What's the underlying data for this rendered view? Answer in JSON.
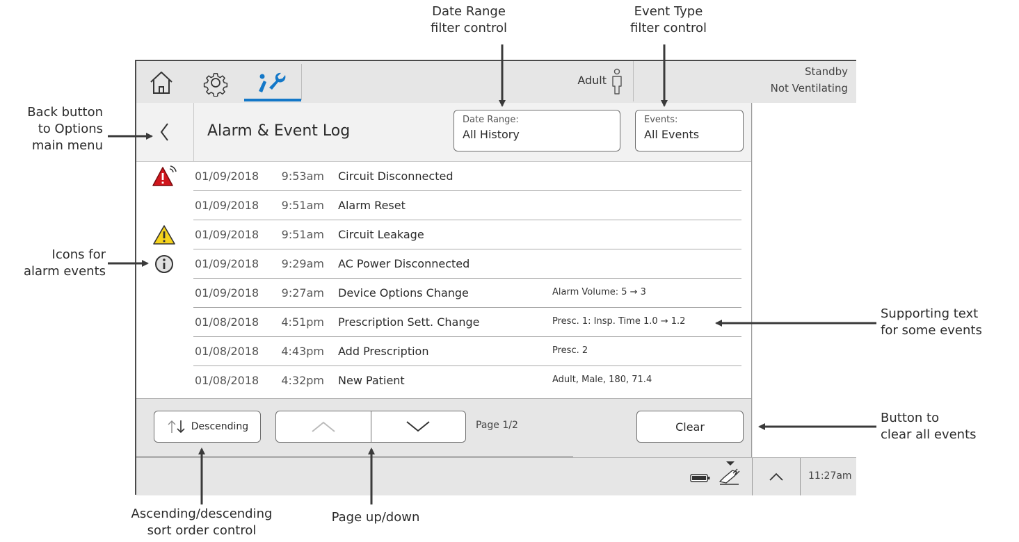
{
  "callouts": {
    "date_range": [
      "Date Range",
      "filter control"
    ],
    "event_type": [
      "Event Type",
      "filter control"
    ],
    "back_button": [
      "Back button",
      "to Options",
      "main menu"
    ],
    "alarm_icons": [
      "Icons for",
      "alarm events"
    ],
    "supporting_text": [
      "Supporting text",
      "for some events"
    ],
    "clear_button": [
      "Button to",
      "clear all events"
    ],
    "sort_order": [
      "Ascending/descending",
      "sort order control"
    ],
    "page_nav": [
      "Page up/down"
    ]
  },
  "topbar": {
    "tabs": [
      {
        "icon": "home-icon"
      },
      {
        "icon": "gear-icon"
      },
      {
        "icon": "tools-icon",
        "active": true
      }
    ],
    "patient_mode": "Adult",
    "patient_icon": "adult-patient-icon",
    "status_line1": "Standby",
    "status_line2": "Not Ventilating",
    "active_tab_color": "#1478c8"
  },
  "panel": {
    "title": "Alarm & Event Log",
    "back_icon": "chevron-left-icon",
    "date_filter": {
      "label": "Date Range:",
      "value": "All History"
    },
    "event_filter": {
      "label": "Events:",
      "value": "All Events"
    }
  },
  "log": [
    {
      "icon": "high-priority-alarm-icon",
      "date": "01/09/2018",
      "time": "9:53am",
      "event": "Circuit Disconnected",
      "note": ""
    },
    {
      "icon": "",
      "date": "01/09/2018",
      "time": "9:51am",
      "event": "Alarm Reset",
      "note": ""
    },
    {
      "icon": "medium-priority-alarm-icon",
      "date": "01/09/2018",
      "time": "9:51am",
      "event": "Circuit Leakage",
      "note": ""
    },
    {
      "icon": "info-icon",
      "date": "01/09/2018",
      "time": "9:29am",
      "event": "AC Power Disconnected",
      "note": ""
    },
    {
      "icon": "",
      "date": "01/09/2018",
      "time": "9:27am",
      "event": "Device Options Change",
      "note": "Alarm Volume:  5 → 3"
    },
    {
      "icon": "",
      "date": "01/08/2018",
      "time": "4:51pm",
      "event": "Prescription Sett. Change",
      "note": "Presc. 1:  Insp. Time 1.0 → 1.2"
    },
    {
      "icon": "",
      "date": "01/08/2018",
      "time": "4:43pm",
      "event": "Add Prescription",
      "note": "Presc. 2"
    },
    {
      "icon": "",
      "date": "01/08/2018",
      "time": "4:32pm",
      "event": "New Patient",
      "note": "Adult, Male, 180, 71.4"
    }
  ],
  "footer": {
    "sort_label": "Descending",
    "sort_icon": "sort-arrows-icon",
    "page_up_icon": "chevron-up-icon",
    "page_down_icon": "chevron-down-icon",
    "page_indicator": "Page 1/2",
    "clear_label": "Clear"
  },
  "status_bar": {
    "battery_icon": "battery-icon",
    "ac_power_icon": "ac-plug-icon",
    "expand_icon": "chevron-up-icon",
    "clock": "11:27am"
  },
  "colors": {
    "alarm_high": "#d0161c",
    "alarm_medium": "#f6d31c",
    "accent": "#1478c8"
  }
}
